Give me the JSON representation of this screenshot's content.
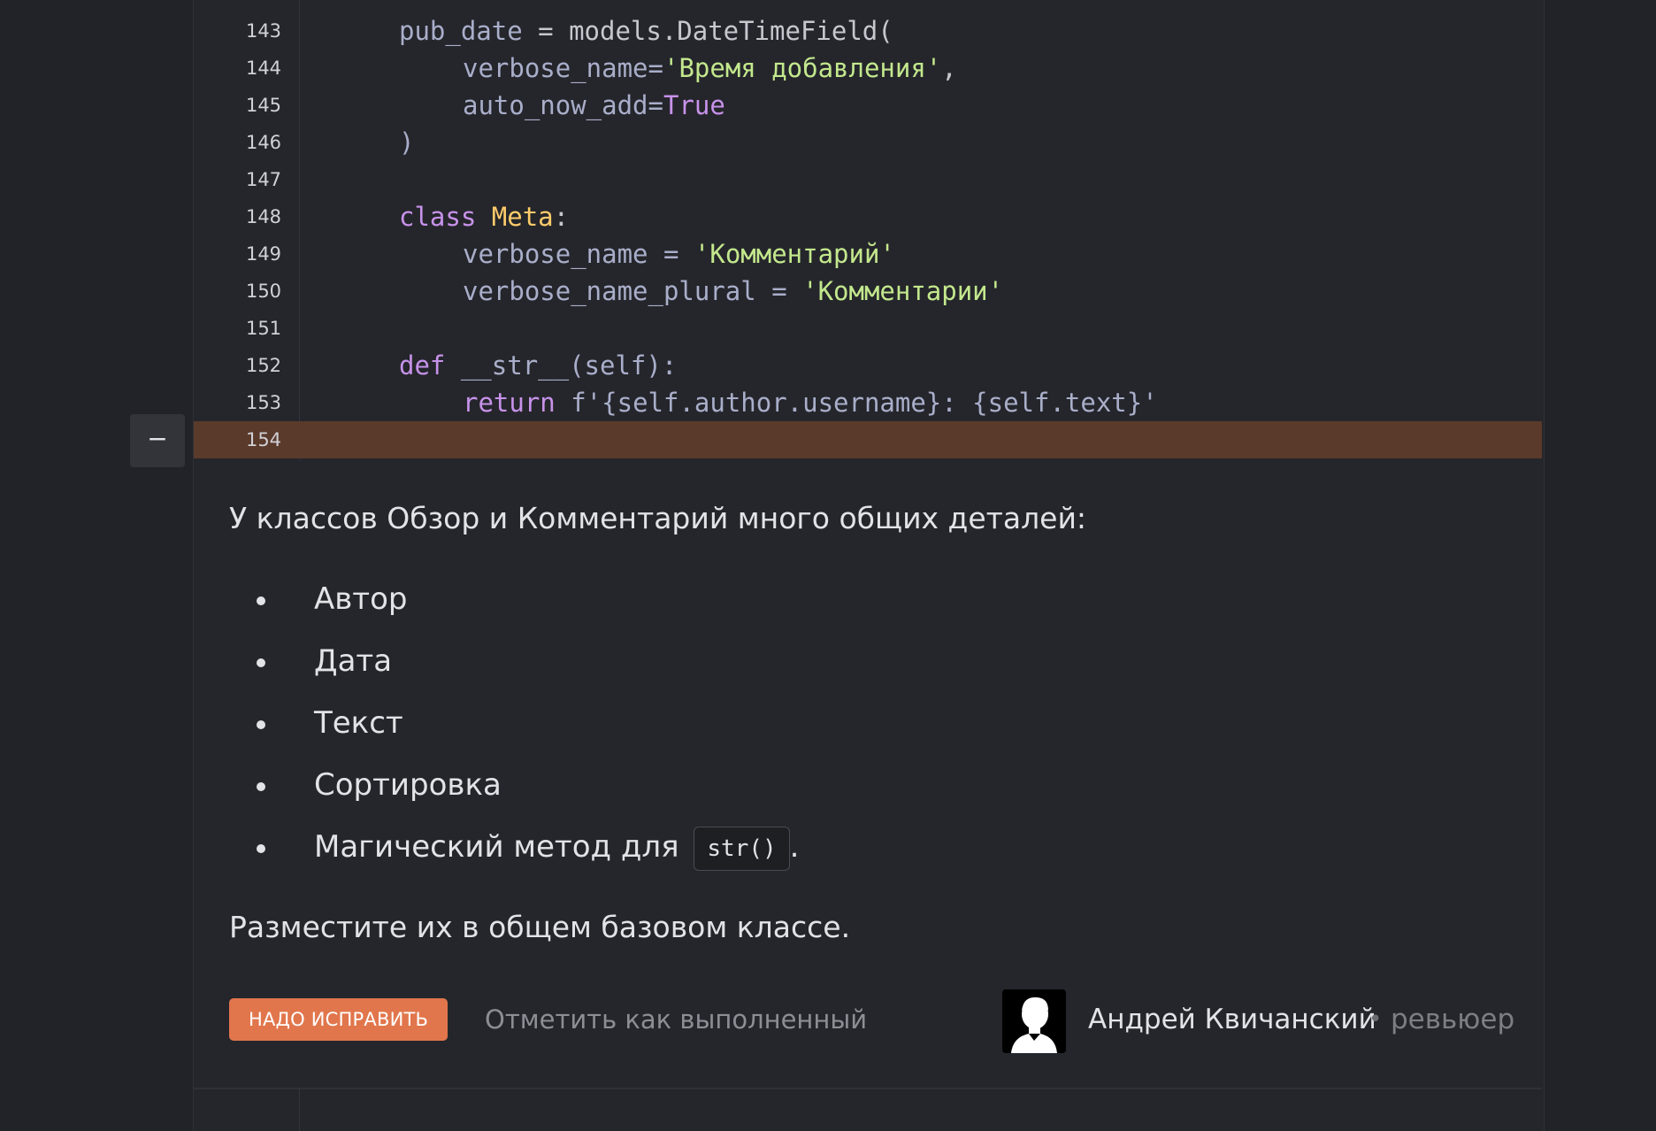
{
  "code": {
    "lines": [
      {
        "n": "143"
      },
      {
        "n": "144"
      },
      {
        "n": "145"
      },
      {
        "n": "146"
      },
      {
        "n": "147"
      },
      {
        "n": "148"
      },
      {
        "n": "149"
      },
      {
        "n": "150"
      },
      {
        "n": "151"
      },
      {
        "n": "152"
      },
      {
        "n": "153"
      },
      {
        "n": "154"
      }
    ],
    "l143": {
      "a": "pub_date",
      "b": " = models.DateTimeField("
    },
    "l144": {
      "a": "verbose_name=",
      "b": "'Время добавления'",
      "c": ","
    },
    "l145": {
      "a": "auto_now_add=",
      "b": "True"
    },
    "l146": {
      "a": ")"
    },
    "l148": {
      "a": "class",
      "b": " ",
      "c": "Meta",
      "d": ":"
    },
    "l149": {
      "a": "verbose_name = ",
      "b": "'Комментарий'"
    },
    "l150": {
      "a": "verbose_name_plural = ",
      "b": "'Комментарии'"
    },
    "l152": {
      "a": "def",
      "b": " __str__(self):"
    },
    "l153": {
      "a": "return",
      "b": " f'{self.author.username}: {self.text}'"
    }
  },
  "collapse_symbol": "−",
  "review": {
    "intro": "У классов Обзор и Комментарий много общих деталей:",
    "items": [
      "Автор",
      "Дата",
      "Текст",
      "Сортировка",
      "Магический метод для"
    ],
    "inline_code": "str()",
    "after_code": ".",
    "outro": "Разместите их в общем базовом классе."
  },
  "footer": {
    "fix_label": "НАДО ИСПРАВИТЬ",
    "mark_done_label": "Отметить как выполненный",
    "reviewer_name": "Андрей Квичанский",
    "separator": "•",
    "reviewer_role": "ревьюер"
  },
  "colors": {
    "keyword": "#c792ea",
    "class_name": "#ffcb6b",
    "string": "#c3e88d",
    "highlight_line": "#5a3a2b",
    "fix_button": "#e1764c"
  }
}
